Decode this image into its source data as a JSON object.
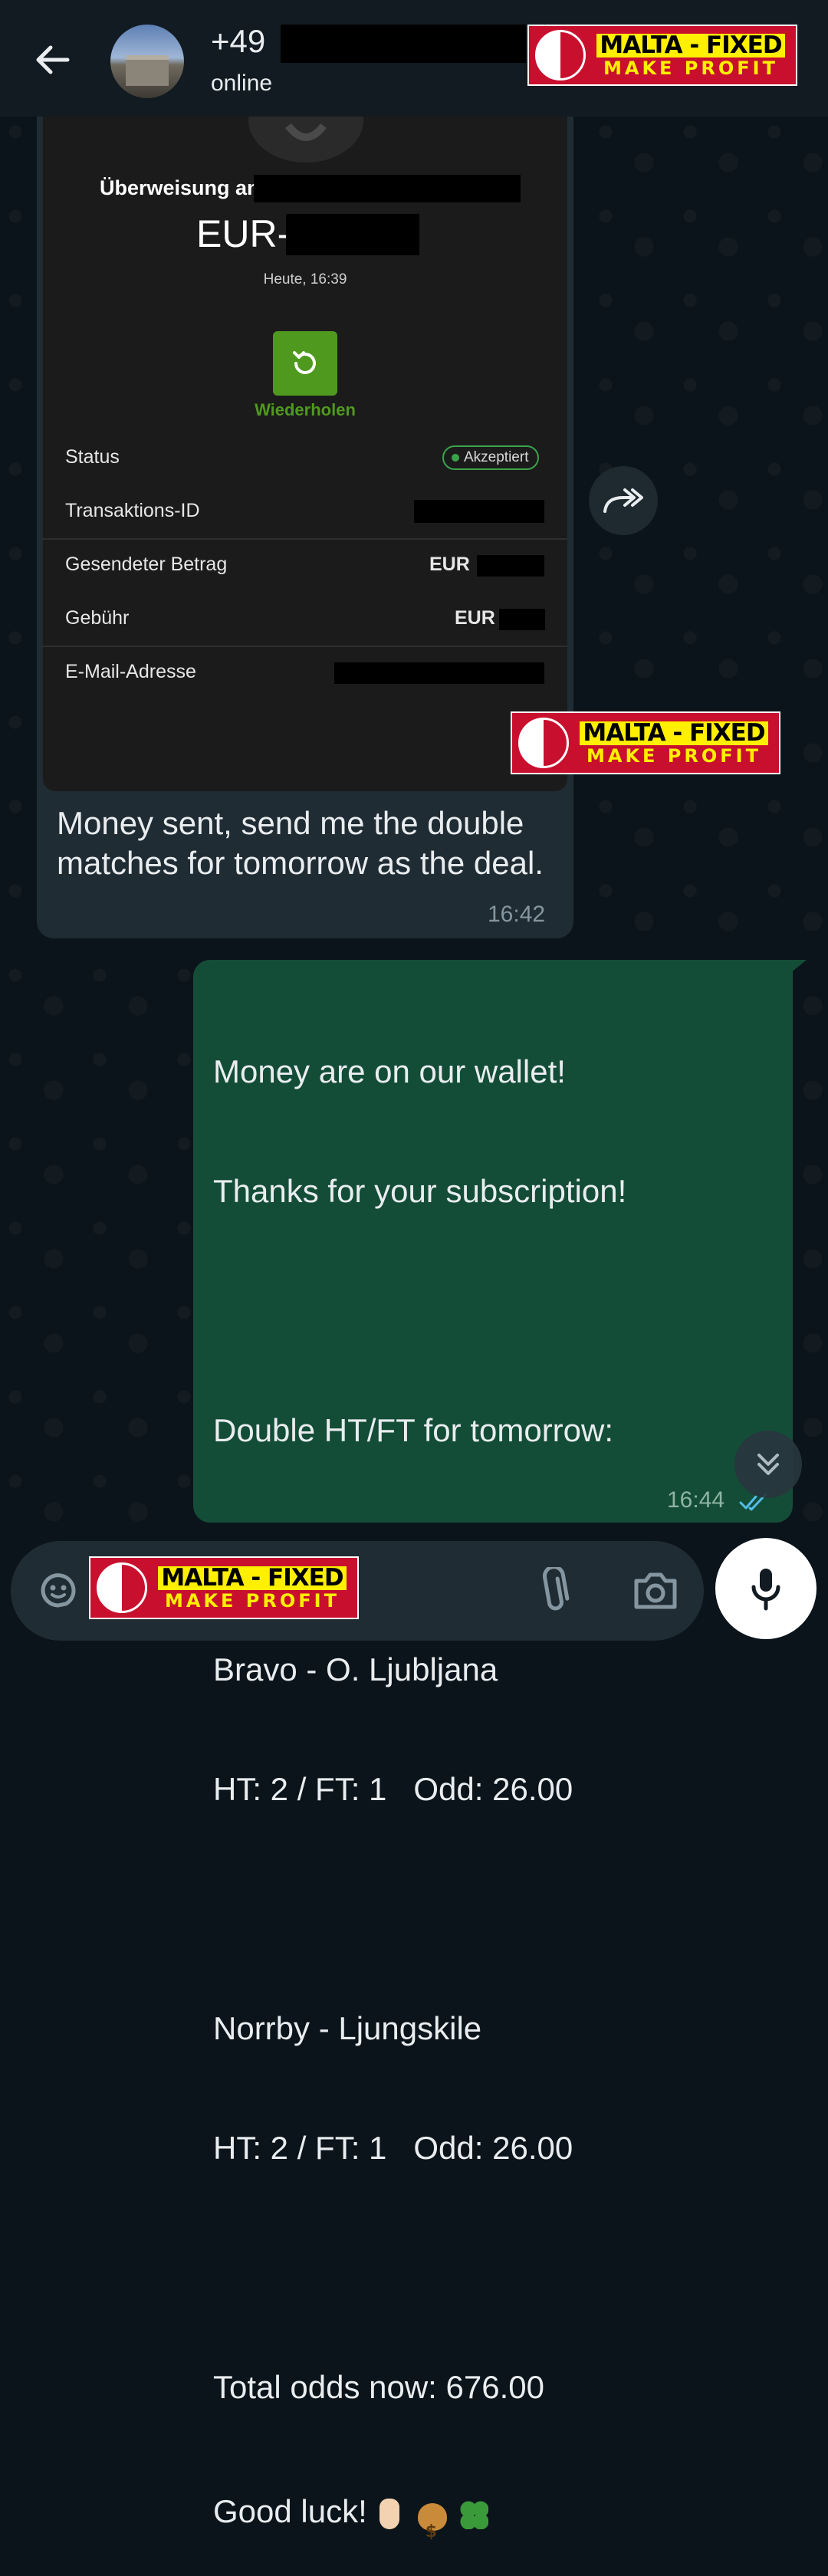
{
  "header": {
    "contact_name": "+49",
    "status": "online"
  },
  "badge": {
    "line1": "MALTA - FIXED",
    "line2": "MAKE PROFIT"
  },
  "transfer_screenshot": {
    "transfer_label": "Überweisung an",
    "amount_prefix": "EUR-",
    "date": "Heute, 16:39",
    "repeat_label": "Wiederholen",
    "rows": {
      "status_label": "Status",
      "status_value": "Akzeptiert",
      "transaction_id_label": "Transaktions-ID",
      "sent_amount_label": "Gesendeter Betrag",
      "sent_amount_currency": "EUR",
      "fee_label": "Gebühr",
      "fee_currency": "EUR",
      "email_label": "E-Mail-Adresse"
    }
  },
  "messages": {
    "incoming": {
      "text": "Money sent, send me the double matches for tomorrow as the deal.",
      "time": "16:42"
    },
    "outgoing": {
      "lines": [
        "Money are on our wallet!",
        "Thanks for your subscription!",
        "",
        "Double HT/FT for tomorrow:",
        "",
        "Bravo - O. Ljubljana",
        "HT: 2 / FT: 1   Odd: 26.00",
        "",
        "Norrby - Ljungskile",
        "HT: 2 / FT: 1   Odd: 26.00",
        "",
        "Total odds now: 676.00"
      ],
      "last_line": "Good luck!",
      "time": "16:44",
      "read_status": "double-check-blue"
    }
  },
  "colors": {
    "background": "#0b141a",
    "header": "#111b21",
    "incoming_bubble": "#202c33",
    "outgoing_bubble": "#144d37",
    "input_bar": "#1f2c33",
    "accent_green": "#4f9a1e",
    "read_ticks": "#53bdeb"
  }
}
